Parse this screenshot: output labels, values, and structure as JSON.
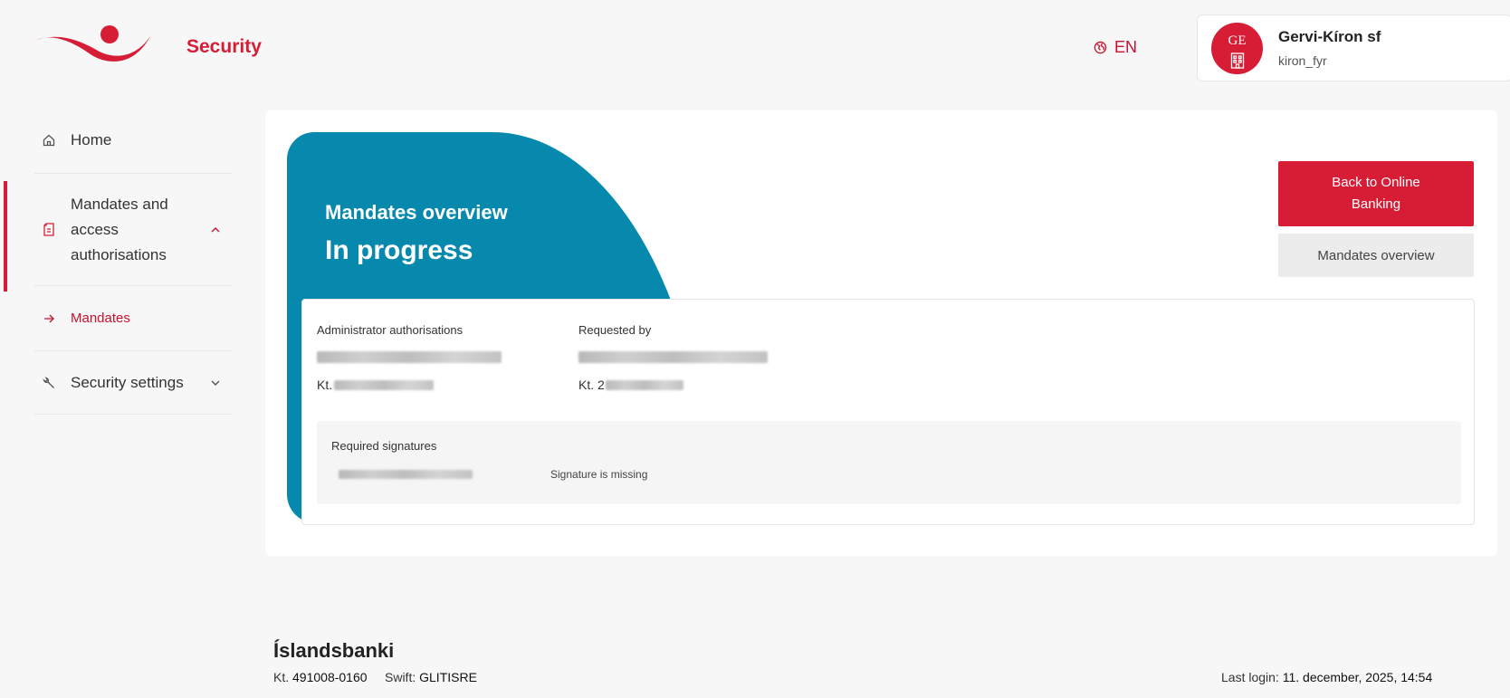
{
  "header": {
    "app_title": "Security",
    "language": "EN",
    "user": {
      "initials": "GE",
      "name": "Gervi-Kíron sf",
      "username": "kiron_fyr"
    }
  },
  "sidebar": {
    "items": [
      {
        "label": "Home",
        "icon": "home-icon"
      },
      {
        "label": "Mandates and access authorisations",
        "icon": "document-icon",
        "expanded": true,
        "active": true
      },
      {
        "label": "Mandates",
        "icon": "arrow-right-icon",
        "sub": true
      },
      {
        "label": "Security settings",
        "icon": "wrench-icon",
        "expanded": false
      }
    ]
  },
  "main": {
    "subtitle": "Mandates overview",
    "title": "In progress",
    "back_button": "Back to Online Banking",
    "overview_button": "Mandates overview",
    "detail": {
      "admin_label": "Administrator authorisations",
      "requested_label": "Requested by",
      "kt_prefix": "Kt.",
      "kt_prefix_requested": "Kt. 2",
      "signatures_title": "Required signatures",
      "signature_status": "Signature is missing"
    }
  },
  "footer": {
    "bank_name": "Íslandsbanki",
    "kt_label": "Kt.",
    "kt_value": "491008-0160",
    "swift_label": "Swift:",
    "swift_value": "GLITISRE",
    "last_login_label": "Last login:",
    "last_login_value": "11. december, 2025, 14:54"
  },
  "colors": {
    "brand_red": "#d71d35",
    "hero_blue": "#0689ad",
    "background": "#f7f7f7"
  }
}
